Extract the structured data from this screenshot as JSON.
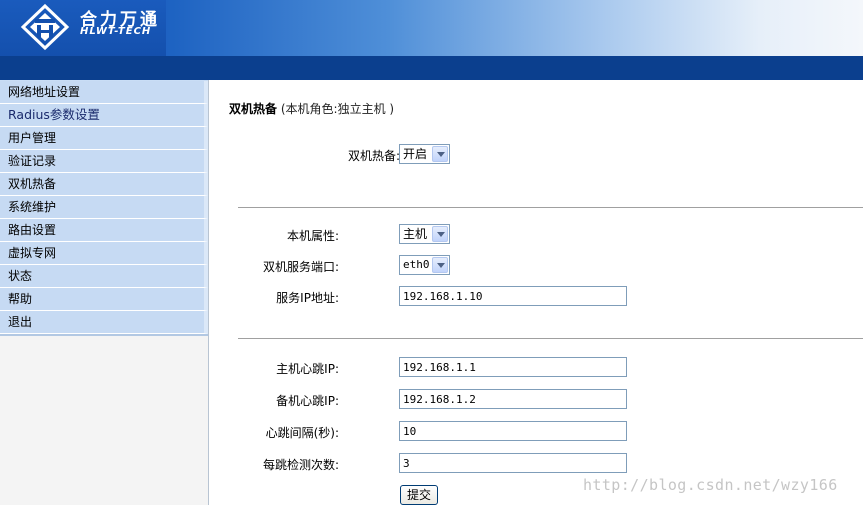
{
  "brand": {
    "name_cn": "合力万通",
    "name_en": "HLWT-TECH"
  },
  "sidebar": {
    "items": [
      {
        "label": "网络地址设置"
      },
      {
        "label": "Radius参数设置"
      },
      {
        "label": "用户管理"
      },
      {
        "label": "验证记录"
      },
      {
        "label": "双机热备"
      },
      {
        "label": "系统维护"
      },
      {
        "label": "路由设置"
      },
      {
        "label": "虚拟专网"
      },
      {
        "label": "状态"
      },
      {
        "label": "帮助"
      },
      {
        "label": "退出"
      }
    ]
  },
  "main": {
    "title": "双机热备",
    "role_text": "(本机角色:独立主机 )",
    "hot_standby": {
      "label": "双机热备:",
      "value": "开启"
    },
    "local_attr": {
      "label": "本机属性:",
      "value": "主机"
    },
    "service_port": {
      "label": "双机服务端口:",
      "value": "eth0"
    },
    "service_ip": {
      "label": "服务IP地址:",
      "value": "192.168.1.10"
    },
    "master_heartbeat_ip": {
      "label": "主机心跳IP:",
      "value": "192.168.1.1"
    },
    "backup_heartbeat_ip": {
      "label": "备机心跳IP:",
      "value": "192.168.1.2"
    },
    "heartbeat_interval": {
      "label": "心跳间隔(秒):",
      "value": "10"
    },
    "heartbeat_checks": {
      "label": "每跳检测次数:",
      "value": "3"
    },
    "submit_label": "提交"
  },
  "watermark": "http://blog.csdn.net/wzy166",
  "colors": {
    "header_blue": "#1553b3",
    "navbar_blue": "#0b3f8e",
    "menu_bg": "#c6daf3"
  },
  "icons": {
    "logo": "hlwt-logo-icon",
    "select_arrow": "chevron-down-icon"
  }
}
